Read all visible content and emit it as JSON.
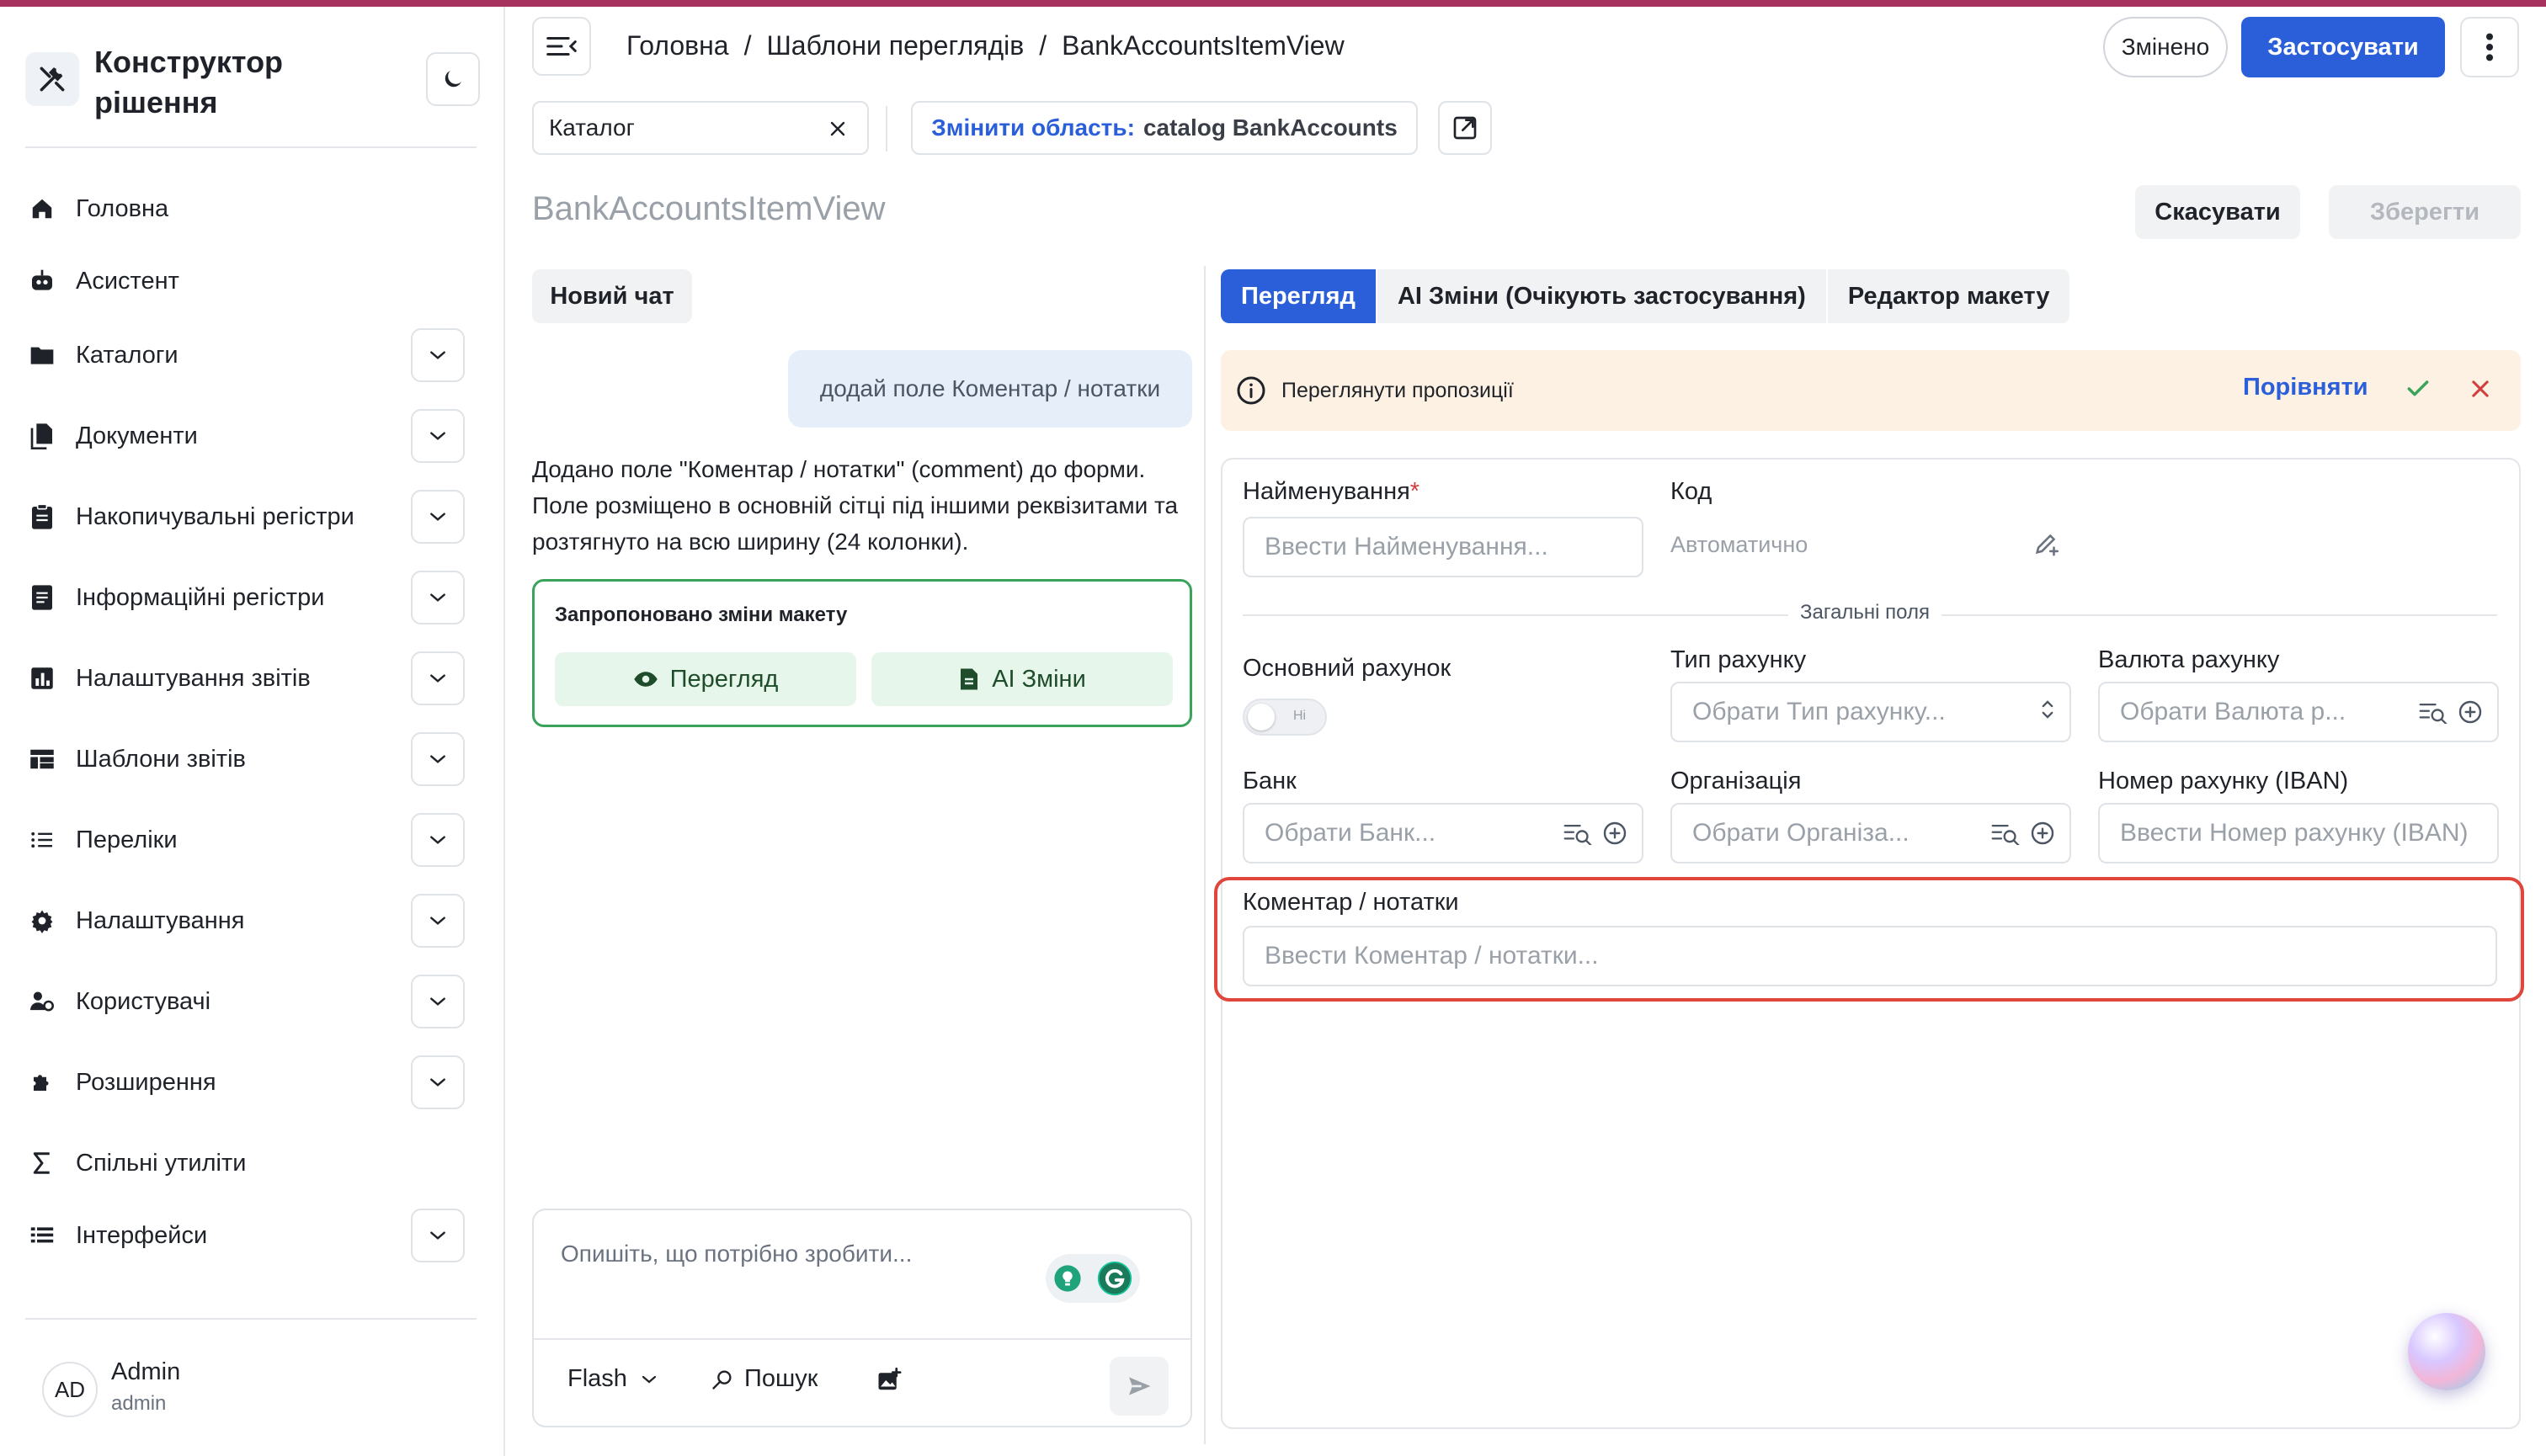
{
  "app": {
    "title": "Конструктор рішення"
  },
  "sidebar": {
    "items": [
      {
        "label": "Головна",
        "icon": "home-icon",
        "expandable": false
      },
      {
        "label": "Асистент",
        "icon": "robot-icon",
        "expandable": false
      },
      {
        "label": "Каталоги",
        "icon": "folder-icon",
        "expandable": true
      },
      {
        "label": "Документи",
        "icon": "documents-icon",
        "expandable": true
      },
      {
        "label": "Накопичувальні регістри",
        "icon": "clipboard-icon",
        "expandable": true
      },
      {
        "label": "Інформаційні регістри",
        "icon": "register-icon",
        "expandable": true
      },
      {
        "label": "Налаштування звітів",
        "icon": "chart-icon",
        "expandable": true
      },
      {
        "label": "Шаблони звітів",
        "icon": "grid-icon",
        "expandable": true
      },
      {
        "label": "Переліки",
        "icon": "list-icon",
        "expandable": true
      },
      {
        "label": "Налаштування",
        "icon": "gear-icon",
        "expandable": true
      },
      {
        "label": "Користувачі",
        "icon": "users-icon",
        "expandable": true
      },
      {
        "label": "Розширення",
        "icon": "puzzle-icon",
        "expandable": true
      },
      {
        "label": "Спільні утиліти",
        "icon": "sigma-icon",
        "expandable": false
      },
      {
        "label": "Інтерфейси",
        "icon": "interfaces-icon",
        "expandable": true
      }
    ],
    "user": {
      "initials": "AD",
      "name": "Admin",
      "login": "admin"
    }
  },
  "header": {
    "breadcrumb": [
      "Головна",
      "Шаблони переглядів",
      "BankAccountsItemView"
    ],
    "changed_label": "Змінено",
    "apply_label": "Застосувати",
    "catalog_value": "Каталог",
    "scope_prefix": "Змінити область:",
    "scope_value": "catalog BankAccounts",
    "page_title": "BankAccountsItemView",
    "cancel_label": "Скасувати",
    "save_label": "Зберегти"
  },
  "chat": {
    "new_chat_label": "Новий чат",
    "user_message": "додай поле Коментар / нотатки",
    "ai_message": "Додано поле \"Коментар / нотатки\" (comment) до форми. Поле розміщено в основній сітці під іншими реквізитами та розтягнуто на всю ширину (24 колонки).",
    "proposal_title": "Запропоновано зміни макету",
    "proposal_view_label": "Перегляд",
    "proposal_ai_label": "AI Зміни",
    "composer_placeholder": "Опишіть, що потрібно зробити...",
    "model_label": "Flash",
    "search_label": "Пошук"
  },
  "editor": {
    "tabs": [
      "Перегляд",
      "AI Зміни (Очікують застосування)",
      "Редактор макету"
    ],
    "active_tab": 0,
    "notice_text": "Переглянути пропозиції",
    "compare_label": "Порівняти",
    "form": {
      "name_label": "Найменування",
      "name_placeholder": "Ввести Найменування...",
      "code_label": "Код",
      "code_value": "Автоматично",
      "section_title": "Загальні поля",
      "main_account_label": "Основний рахунок",
      "toggle_off_label": "Ні",
      "account_type_label": "Тип рахунку",
      "account_type_placeholder": "Обрати Тип рахунку...",
      "currency_label": "Валюта рахунку",
      "currency_placeholder": "Обрати Валюта р...",
      "bank_label": "Банк",
      "bank_placeholder": "Обрати Банк...",
      "org_label": "Організація",
      "org_placeholder": "Обрати Організа...",
      "iban_label": "Номер рахунку (IBAN)",
      "iban_placeholder": "Ввести Номер рахунку (IBAN)",
      "comment_label": "Коментар / нотатки",
      "comment_placeholder": "Ввести Коментар / нотатки..."
    }
  },
  "colors": {
    "accent": "#2b5fd9",
    "top_line": "#a8325e",
    "highlight": "#e0463c",
    "success": "#3aa35a",
    "notice_bg": "#fdf1e3"
  }
}
